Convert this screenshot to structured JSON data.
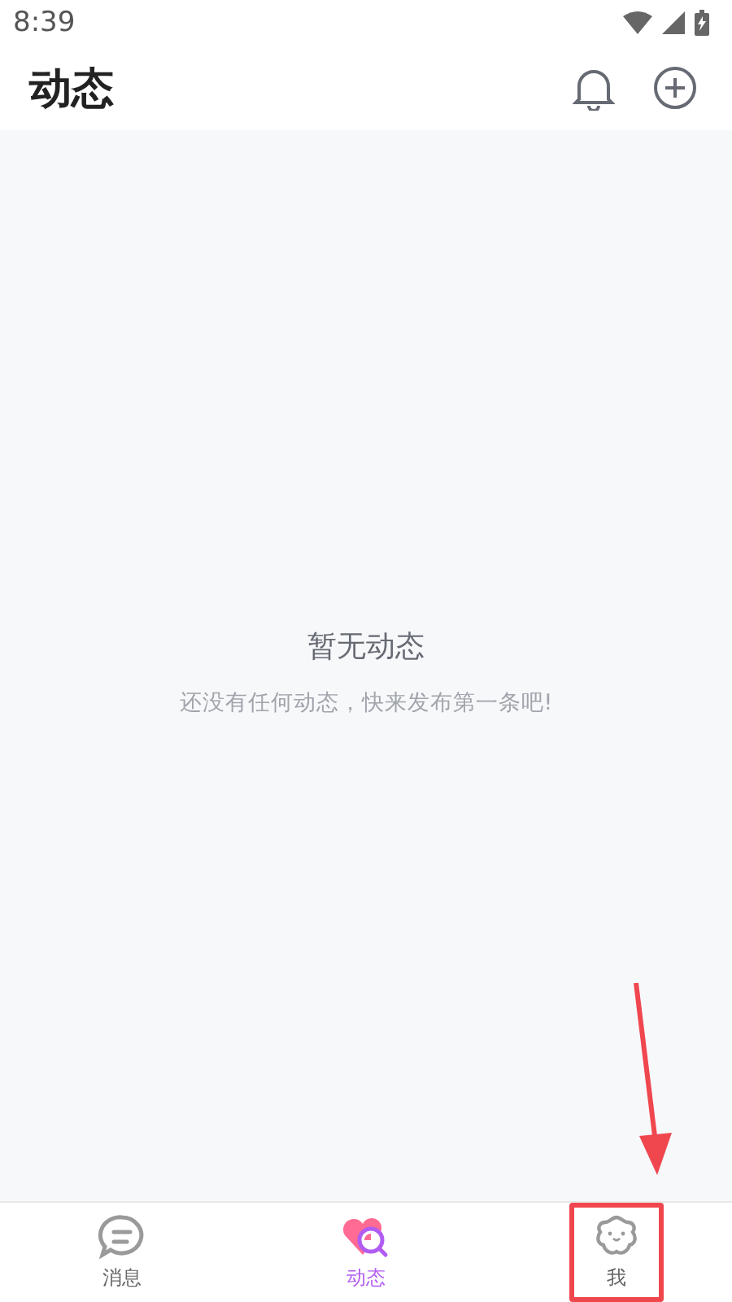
{
  "status_bar": {
    "time": "8:39"
  },
  "header": {
    "title": "动态"
  },
  "empty_state": {
    "title": "暂无动态",
    "message": "还没有任何动态，快来发布第一条吧!"
  },
  "tabs": [
    {
      "kind": "message",
      "label": "消息",
      "selected": false,
      "highlighted": false
    },
    {
      "kind": "moments",
      "label": "动态",
      "selected": true,
      "highlighted": false
    },
    {
      "kind": "me",
      "label": "我",
      "selected": false,
      "highlighted": true
    }
  ]
}
